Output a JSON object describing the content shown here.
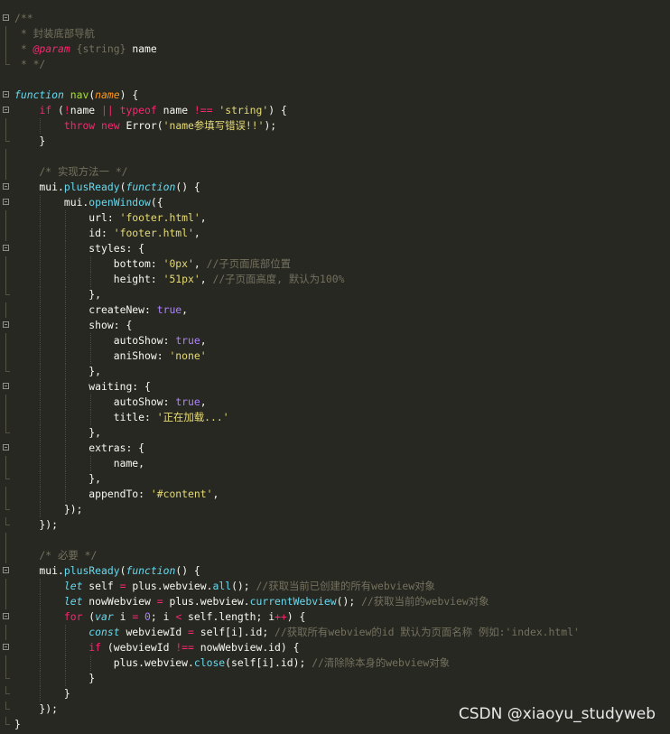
{
  "watermark": "CSDN @xiaoyu_studyweb",
  "colors": {
    "background": "#272822",
    "comment": "#75715e",
    "keyword": "#f92672",
    "storage": "#66d9ef",
    "function_name": "#a6e22e",
    "parameter": "#fd971f",
    "string": "#e6db74",
    "boolean": "#ae81ff"
  },
  "lines": [
    {
      "fold": "box",
      "tokens": [
        {
          "t": "/**",
          "c": "comment"
        }
      ]
    },
    {
      "fold": "bar",
      "tokens": [
        {
          "t": " * 封装底部导航",
          "c": "comment"
        }
      ]
    },
    {
      "fold": "bar",
      "tokens": [
        {
          "t": " * ",
          "c": "comment"
        },
        {
          "t": "@param",
          "c": "tag"
        },
        {
          "t": " {string} ",
          "c": "comment"
        },
        {
          "t": "name",
          "c": "plain"
        }
      ]
    },
    {
      "fold": "end",
      "tokens": [
        {
          "t": " * */",
          "c": "comment"
        }
      ]
    },
    {
      "fold": "",
      "tokens": []
    },
    {
      "fold": "box",
      "tokens": [
        {
          "t": "function",
          "c": "storage"
        },
        {
          "t": " ",
          "c": "plain"
        },
        {
          "t": "nav",
          "c": "func"
        },
        {
          "t": "(",
          "c": "plain"
        },
        {
          "t": "name",
          "c": "param"
        },
        {
          "t": ") {",
          "c": "plain"
        }
      ]
    },
    {
      "fold": "box",
      "tokens": [
        {
          "t": "    ",
          "c": "plain"
        },
        {
          "t": "if",
          "c": "keyword"
        },
        {
          "t": " (",
          "c": "plain"
        },
        {
          "t": "!",
          "c": "op"
        },
        {
          "t": "name ",
          "c": "plain"
        },
        {
          "t": "||",
          "c": "op"
        },
        {
          "t": " ",
          "c": "plain"
        },
        {
          "t": "typeof",
          "c": "keyword"
        },
        {
          "t": " name ",
          "c": "plain"
        },
        {
          "t": "!==",
          "c": "op"
        },
        {
          "t": " ",
          "c": "plain"
        },
        {
          "t": "'string'",
          "c": "string"
        },
        {
          "t": ") {",
          "c": "plain"
        }
      ]
    },
    {
      "fold": "bar",
      "tokens": [
        {
          "t": "        ",
          "c": "plain"
        },
        {
          "t": "throw",
          "c": "keyword"
        },
        {
          "t": " ",
          "c": "plain"
        },
        {
          "t": "new",
          "c": "keyword"
        },
        {
          "t": " Error(",
          "c": "plain"
        },
        {
          "t": "'name参填写错误!!'",
          "c": "string"
        },
        {
          "t": ");",
          "c": "plain"
        }
      ]
    },
    {
      "fold": "end",
      "tokens": [
        {
          "t": "    }",
          "c": "plain"
        }
      ]
    },
    {
      "fold": "bar",
      "tokens": []
    },
    {
      "fold": "bar",
      "tokens": [
        {
          "t": "    /* 实现方法一 */",
          "c": "comment"
        }
      ]
    },
    {
      "fold": "box",
      "tokens": [
        {
          "t": "    mui.",
          "c": "plain"
        },
        {
          "t": "plusReady",
          "c": "method"
        },
        {
          "t": "(",
          "c": "plain"
        },
        {
          "t": "function",
          "c": "storage"
        },
        {
          "t": "() {",
          "c": "plain"
        }
      ]
    },
    {
      "fold": "box",
      "tokens": [
        {
          "t": "        mui.",
          "c": "plain"
        },
        {
          "t": "openWindow",
          "c": "method"
        },
        {
          "t": "({",
          "c": "plain"
        }
      ]
    },
    {
      "fold": "bar",
      "tokens": [
        {
          "t": "            url: ",
          "c": "plain"
        },
        {
          "t": "'footer.html'",
          "c": "string"
        },
        {
          "t": ",",
          "c": "plain"
        }
      ]
    },
    {
      "fold": "bar",
      "tokens": [
        {
          "t": "            id: ",
          "c": "plain"
        },
        {
          "t": "'footer.html'",
          "c": "string"
        },
        {
          "t": ",",
          "c": "plain"
        }
      ]
    },
    {
      "fold": "box",
      "tokens": [
        {
          "t": "            styles: {",
          "c": "plain"
        }
      ]
    },
    {
      "fold": "bar",
      "tokens": [
        {
          "t": "                bottom: ",
          "c": "plain"
        },
        {
          "t": "'0px'",
          "c": "string"
        },
        {
          "t": ", ",
          "c": "plain"
        },
        {
          "t": "//子页面底部位置",
          "c": "comment"
        }
      ]
    },
    {
      "fold": "bar",
      "tokens": [
        {
          "t": "                height: ",
          "c": "plain"
        },
        {
          "t": "'51px'",
          "c": "string"
        },
        {
          "t": ", ",
          "c": "plain"
        },
        {
          "t": "//子页面高度, 默认为100%",
          "c": "comment"
        }
      ]
    },
    {
      "fold": "end",
      "tokens": [
        {
          "t": "            },",
          "c": "plain"
        }
      ]
    },
    {
      "fold": "bar",
      "tokens": [
        {
          "t": "            createNew: ",
          "c": "plain"
        },
        {
          "t": "true",
          "c": "bool"
        },
        {
          "t": ",",
          "c": "plain"
        }
      ]
    },
    {
      "fold": "box",
      "tokens": [
        {
          "t": "            show: {",
          "c": "plain"
        }
      ]
    },
    {
      "fold": "bar",
      "tokens": [
        {
          "t": "                autoShow: ",
          "c": "plain"
        },
        {
          "t": "true",
          "c": "bool"
        },
        {
          "t": ",",
          "c": "plain"
        }
      ]
    },
    {
      "fold": "bar",
      "tokens": [
        {
          "t": "                aniShow: ",
          "c": "plain"
        },
        {
          "t": "'none'",
          "c": "string"
        }
      ]
    },
    {
      "fold": "end",
      "tokens": [
        {
          "t": "            },",
          "c": "plain"
        }
      ]
    },
    {
      "fold": "box",
      "tokens": [
        {
          "t": "            waiting: {",
          "c": "plain"
        }
      ]
    },
    {
      "fold": "bar",
      "tokens": [
        {
          "t": "                autoShow: ",
          "c": "plain"
        },
        {
          "t": "true",
          "c": "bool"
        },
        {
          "t": ",",
          "c": "plain"
        }
      ]
    },
    {
      "fold": "bar",
      "tokens": [
        {
          "t": "                title: ",
          "c": "plain"
        },
        {
          "t": "'正在加载...'",
          "c": "string"
        }
      ]
    },
    {
      "fold": "end",
      "tokens": [
        {
          "t": "            },",
          "c": "plain"
        }
      ]
    },
    {
      "fold": "box",
      "tokens": [
        {
          "t": "            extras: {",
          "c": "plain"
        }
      ]
    },
    {
      "fold": "bar",
      "tokens": [
        {
          "t": "                name,",
          "c": "plain"
        }
      ]
    },
    {
      "fold": "end",
      "tokens": [
        {
          "t": "            },",
          "c": "plain"
        }
      ]
    },
    {
      "fold": "bar",
      "tokens": [
        {
          "t": "            appendTo: ",
          "c": "plain"
        },
        {
          "t": "'#content'",
          "c": "string"
        },
        {
          "t": ",",
          "c": "plain"
        }
      ]
    },
    {
      "fold": "end",
      "tokens": [
        {
          "t": "        });",
          "c": "plain"
        }
      ]
    },
    {
      "fold": "end",
      "tokens": [
        {
          "t": "    });",
          "c": "plain"
        }
      ]
    },
    {
      "fold": "bar",
      "tokens": []
    },
    {
      "fold": "bar",
      "tokens": [
        {
          "t": "    /* 必要 */",
          "c": "comment"
        }
      ]
    },
    {
      "fold": "box",
      "tokens": [
        {
          "t": "    mui.",
          "c": "plain"
        },
        {
          "t": "plusReady",
          "c": "method"
        },
        {
          "t": "(",
          "c": "plain"
        },
        {
          "t": "function",
          "c": "storage"
        },
        {
          "t": "() {",
          "c": "plain"
        }
      ]
    },
    {
      "fold": "bar",
      "tokens": [
        {
          "t": "        ",
          "c": "plain"
        },
        {
          "t": "let",
          "c": "storage"
        },
        {
          "t": " self ",
          "c": "plain"
        },
        {
          "t": "=",
          "c": "op"
        },
        {
          "t": " plus.webview.",
          "c": "plain"
        },
        {
          "t": "all",
          "c": "method"
        },
        {
          "t": "(); ",
          "c": "plain"
        },
        {
          "t": "//获取当前已创建的所有webview对象",
          "c": "comment"
        }
      ]
    },
    {
      "fold": "bar",
      "tokens": [
        {
          "t": "        ",
          "c": "plain"
        },
        {
          "t": "let",
          "c": "storage"
        },
        {
          "t": " nowWebview ",
          "c": "plain"
        },
        {
          "t": "=",
          "c": "op"
        },
        {
          "t": " plus.webview.",
          "c": "plain"
        },
        {
          "t": "currentWebview",
          "c": "method"
        },
        {
          "t": "(); ",
          "c": "plain"
        },
        {
          "t": "//获取当前的webview对象",
          "c": "comment"
        }
      ]
    },
    {
      "fold": "box",
      "tokens": [
        {
          "t": "        ",
          "c": "plain"
        },
        {
          "t": "for",
          "c": "keyword"
        },
        {
          "t": " (",
          "c": "plain"
        },
        {
          "t": "var",
          "c": "storage"
        },
        {
          "t": " i ",
          "c": "plain"
        },
        {
          "t": "=",
          "c": "op"
        },
        {
          "t": " ",
          "c": "plain"
        },
        {
          "t": "0",
          "c": "num"
        },
        {
          "t": "; i ",
          "c": "plain"
        },
        {
          "t": "<",
          "c": "op"
        },
        {
          "t": " self.length; i",
          "c": "plain"
        },
        {
          "t": "++",
          "c": "op"
        },
        {
          "t": ") {",
          "c": "plain"
        }
      ]
    },
    {
      "fold": "bar",
      "tokens": [
        {
          "t": "            ",
          "c": "plain"
        },
        {
          "t": "const",
          "c": "storage"
        },
        {
          "t": " webviewId ",
          "c": "plain"
        },
        {
          "t": "=",
          "c": "op"
        },
        {
          "t": " self[i].id; ",
          "c": "plain"
        },
        {
          "t": "//获取所有webview的id 默认为页面名称 例如:'index.html'",
          "c": "comment"
        }
      ]
    },
    {
      "fold": "box",
      "tokens": [
        {
          "t": "            ",
          "c": "plain"
        },
        {
          "t": "if",
          "c": "keyword"
        },
        {
          "t": " (webviewId ",
          "c": "plain"
        },
        {
          "t": "!==",
          "c": "op"
        },
        {
          "t": " nowWebview.id) {",
          "c": "plain"
        }
      ]
    },
    {
      "fold": "bar",
      "tokens": [
        {
          "t": "                plus.webview.",
          "c": "plain"
        },
        {
          "t": "close",
          "c": "method"
        },
        {
          "t": "(self[i].id); ",
          "c": "plain"
        },
        {
          "t": "//清除除本身的webview对象",
          "c": "comment"
        }
      ]
    },
    {
      "fold": "end",
      "tokens": [
        {
          "t": "            }",
          "c": "plain"
        }
      ]
    },
    {
      "fold": "end",
      "tokens": [
        {
          "t": "        }",
          "c": "plain"
        }
      ]
    },
    {
      "fold": "end",
      "tokens": [
        {
          "t": "    });",
          "c": "plain"
        }
      ]
    },
    {
      "fold": "end",
      "tokens": [
        {
          "t": "}",
          "c": "plain"
        }
      ]
    }
  ]
}
